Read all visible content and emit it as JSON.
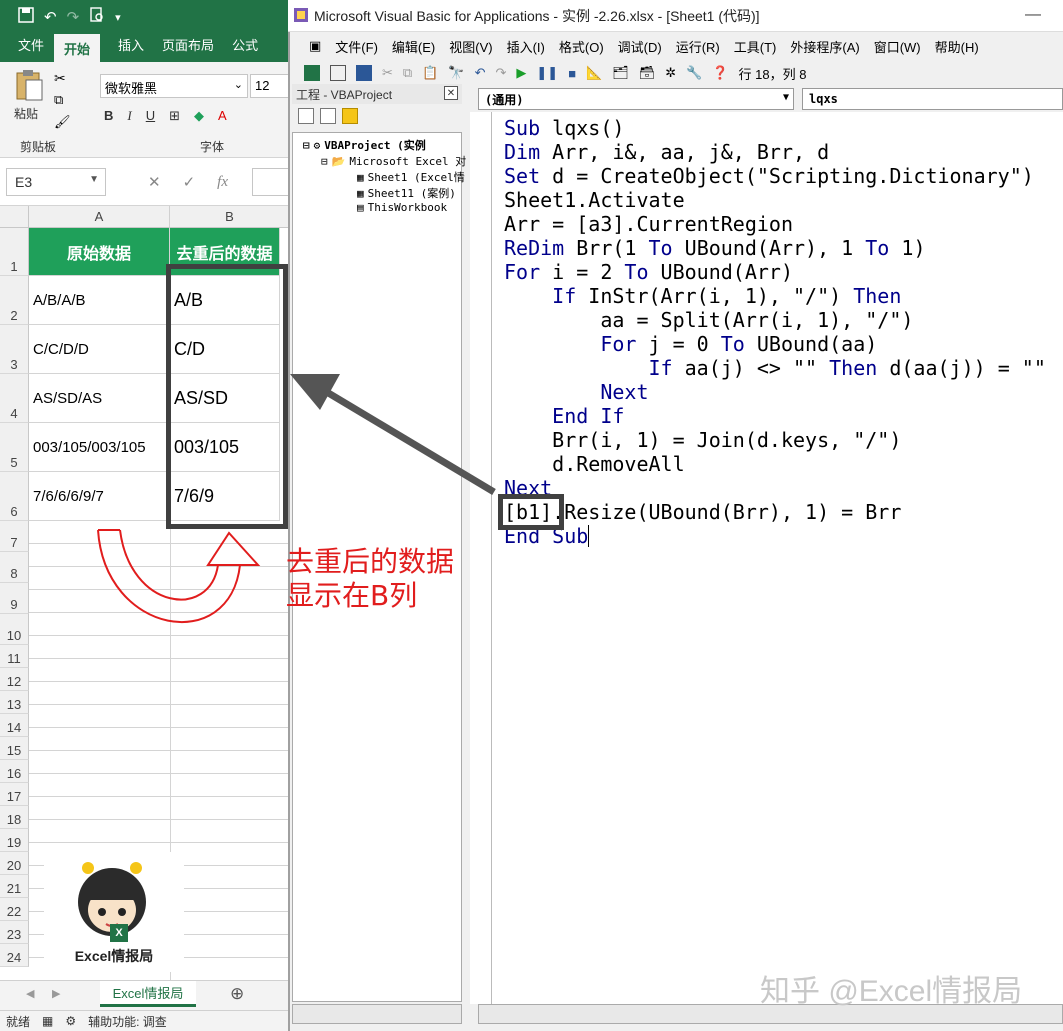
{
  "excel": {
    "tabs": [
      "文件",
      "开始",
      "插入",
      "页面布局",
      "公式"
    ],
    "active_tab": "开始",
    "font_name": "微软雅黑",
    "font_size": "12",
    "paste_label": "粘贴",
    "group_clipboard": "剪贴板",
    "group_font": "字体",
    "bold": "B",
    "italic": "I",
    "underline": "U",
    "font_a": "A",
    "name_box": "E3",
    "fx": "fx",
    "columns": [
      "A",
      "B"
    ],
    "rows": [
      "1",
      "2",
      "3",
      "4",
      "5",
      "6",
      "7",
      "8",
      "9",
      "10",
      "11",
      "12",
      "13",
      "14",
      "15",
      "16",
      "17",
      "18",
      "19",
      "20",
      "21",
      "22",
      "23",
      "24"
    ],
    "header_a": "原始数据",
    "header_b": "去重后的数据",
    "data_a": [
      "A/B/A/B",
      "C/C/D/D",
      "AS/SD/AS",
      "003/105/003/105",
      "7/6/6/6/9/7"
    ],
    "data_b": [
      "A/B",
      "C/D",
      "AS/SD",
      "003/105",
      "7/6/9"
    ],
    "sheet_tab": "Excel情报局",
    "status_ready": "就绪",
    "status_access": "辅助功能: 调查",
    "logo_text": "Excel情报局",
    "logo_badge": "X"
  },
  "vba": {
    "title": "Microsoft Visual Basic for Applications - 实例 -2.26.xlsx - [Sheet1 (代码)]",
    "menu": [
      "文件(F)",
      "编辑(E)",
      "视图(V)",
      "插入(I)",
      "格式(O)",
      "调试(D)",
      "运行(R)",
      "工具(T)",
      "外接程序(A)",
      "窗口(W)",
      "帮助(H)"
    ],
    "cursor_pos": "行 18，列 8",
    "project_title": "工程 - VBAProject",
    "project_close": "✕",
    "tree": [
      "VBAProject (实例",
      "Microsoft Excel 对",
      "Sheet1 (Excel情",
      "Sheet11 (案例)",
      "ThisWorkbook"
    ],
    "combo_left": "(通用)",
    "combo_right": "lqxs",
    "code": [
      "Sub lqxs()",
      "Dim Arr, i&, aa, j&, Brr, d",
      "Set d = CreateObject(\"Scripting.Dictionary\")",
      "Sheet1.Activate",
      "Arr = [a3].CurrentRegion",
      "ReDim Brr(1 To UBound(Arr), 1 To 1)",
      "For i = 2 To UBound(Arr)",
      "    If InStr(Arr(i, 1), \"/\") Then",
      "        aa = Split(Arr(i, 1), \"/\")",
      "        For j = 0 To UBound(aa)",
      "            If aa(j) <> \"\" Then d(aa(j)) = \"\"",
      "        Next",
      "    End If",
      "    Brr(i, 1) = Join(d.keys, \"/\")",
      "    d.RemoveAll",
      "Next",
      "[b1].Resize(UBound(Brr), 1) = Brr",
      "End Sub"
    ]
  },
  "annotation": {
    "line1": "去重后的数据",
    "line2": "显示在B列"
  },
  "watermark": "知乎 @Excel情报局",
  "colors": {
    "excel_green": "#217346",
    "header_green": "#1fa05a",
    "annot_red": "#e11d1d",
    "keyword_blue": "#00008b"
  }
}
